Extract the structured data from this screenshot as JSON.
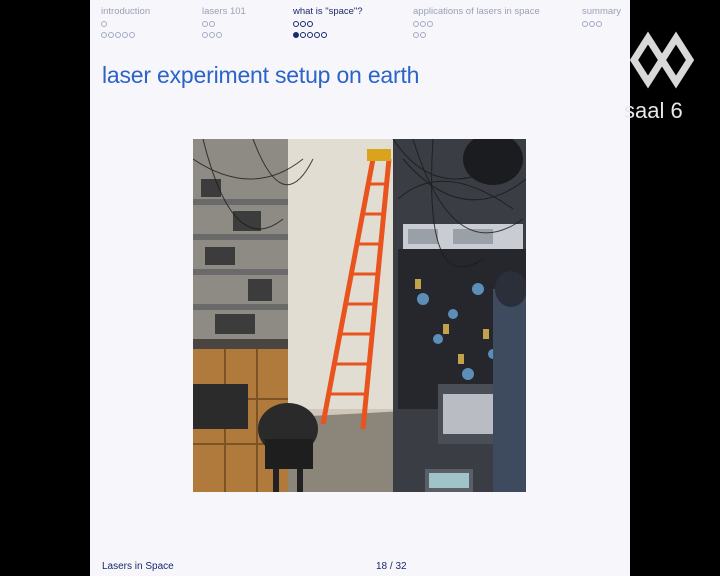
{
  "nav": {
    "sections": [
      {
        "title": "introduction",
        "rows": [
          [
            0
          ],
          [
            0,
            0,
            0,
            0,
            0
          ]
        ],
        "active": false
      },
      {
        "title": "lasers 101",
        "rows": [
          [
            0,
            0
          ],
          [
            0,
            0,
            0
          ]
        ],
        "active": false
      },
      {
        "title": "what is \"space\"?",
        "rows": [
          [
            0,
            0,
            0
          ],
          [
            1,
            0,
            0,
            0,
            0
          ]
        ],
        "active": true
      },
      {
        "title": "applications of lasers in space",
        "rows": [
          [
            0,
            0,
            0
          ],
          [
            0,
            0
          ]
        ],
        "active": false
      },
      {
        "title": "summary",
        "rows": [
          [
            0,
            0,
            0
          ]
        ],
        "active": false
      }
    ]
  },
  "frame_title": "laser experiment setup on earth",
  "footer": {
    "talk_title": "Lasers in Space",
    "page": "18 / 32"
  },
  "overlay": {
    "room_label": "saal 6",
    "logo_icon": "channel-logo-icon"
  },
  "colors": {
    "title_blue": "#2b63c9",
    "nav_dark": "#1b2a6b",
    "nav_muted": "#9aa0b8",
    "ladder_orange": "#e8531e"
  }
}
